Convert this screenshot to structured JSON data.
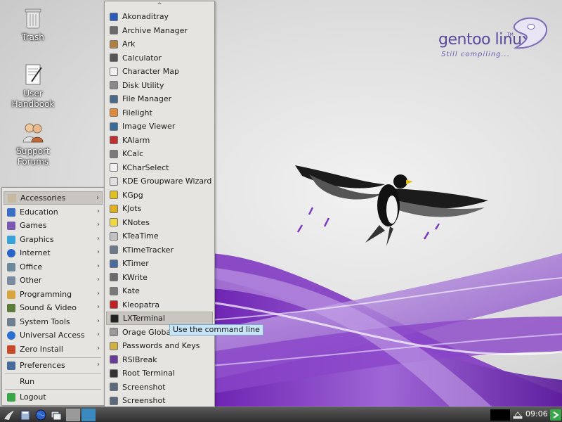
{
  "desktop_icons": [
    {
      "label": "Trash",
      "icon": "trash-icon"
    },
    {
      "label": "User\nHandbook",
      "icon": "handbook-icon"
    },
    {
      "label": "Support\nForums",
      "icon": "support-forums-icon"
    }
  ],
  "branding": {
    "name": "gentoo linux",
    "tm": "TM",
    "tagline": "Still compiling..."
  },
  "main_menu": {
    "categories": [
      {
        "label": "Accessories",
        "icon": "accessories-icon",
        "color": "#c7b8a0",
        "highlighted": true
      },
      {
        "label": "Education",
        "icon": "education-icon",
        "color": "#3a6fc4"
      },
      {
        "label": "Games",
        "icon": "games-icon",
        "color": "#7a5ab0"
      },
      {
        "label": "Graphics",
        "icon": "graphics-icon",
        "color": "#3aa0d8"
      },
      {
        "label": "Internet",
        "icon": "internet-icon",
        "color": "#2b63c9"
      },
      {
        "label": "Office",
        "icon": "office-icon",
        "color": "#6d8a9c"
      },
      {
        "label": "Other",
        "icon": "other-icon",
        "color": "#7a8aa0"
      },
      {
        "label": "Programming",
        "icon": "programming-icon",
        "color": "#d8a640"
      },
      {
        "label": "Sound & Video",
        "icon": "sound-video-icon",
        "color": "#5c7a3a"
      },
      {
        "label": "System Tools",
        "icon": "system-tools-icon",
        "color": "#6f7f8f"
      },
      {
        "label": "Universal Access",
        "icon": "universal-access-icon",
        "color": "#2a6fd0"
      },
      {
        "label": "Zero Install",
        "icon": "zero-install-icon",
        "color": "#c94a2a"
      }
    ],
    "preferences": {
      "label": "Preferences",
      "icon": "preferences-icon",
      "color": "#4a6a9a"
    },
    "run": {
      "label": "Run"
    },
    "logout": {
      "label": "Logout",
      "icon": "logout-icon",
      "color": "#3aa64a"
    }
  },
  "sub_menu": {
    "up_arrow": "^",
    "down_arrow": "v",
    "items": [
      {
        "label": "Akonaditray",
        "icon": "akonaditray-icon",
        "color": "#2a5bbf"
      },
      {
        "label": "Archive Manager",
        "icon": "archive-manager-icon",
        "color": "#6a6a6a"
      },
      {
        "label": "Ark",
        "icon": "ark-icon",
        "color": "#b08040"
      },
      {
        "label": "Calculator",
        "icon": "calculator-icon",
        "color": "#555555"
      },
      {
        "label": "Character Map",
        "icon": "character-map-icon",
        "color": "#f0f0f0"
      },
      {
        "label": "Disk Utility",
        "icon": "disk-utility-icon",
        "color": "#8a8a8a"
      },
      {
        "label": "File Manager",
        "icon": "file-manager-icon",
        "color": "#4a6a8a"
      },
      {
        "label": "Filelight",
        "icon": "filelight-icon",
        "color": "#e08a3a"
      },
      {
        "label": "Image Viewer",
        "icon": "image-viewer-icon",
        "color": "#3a6a9a"
      },
      {
        "label": "KAlarm",
        "icon": "kalarm-icon",
        "color": "#c03030"
      },
      {
        "label": "KCalc",
        "icon": "kcalc-icon",
        "color": "#7a7a7a"
      },
      {
        "label": "KCharSelect",
        "icon": "kcharselect-icon",
        "color": "#f0f0f0"
      },
      {
        "label": "KDE Groupware Wizard",
        "icon": "groupware-wizard-icon",
        "color": "#e0e0e0"
      },
      {
        "label": "KGpg",
        "icon": "kgpg-icon",
        "color": "#e0c020"
      },
      {
        "label": "KJots",
        "icon": "kjots-icon",
        "color": "#e0b020"
      },
      {
        "label": "KNotes",
        "icon": "knotes-icon",
        "color": "#f0d840"
      },
      {
        "label": "KTeaTime",
        "icon": "kteatime-icon",
        "color": "#c0c0c0"
      },
      {
        "label": "KTimeTracker",
        "icon": "ktimetracker-icon",
        "color": "#6a7a8a"
      },
      {
        "label": "KTimer",
        "icon": "ktimer-icon",
        "color": "#4a6aa0"
      },
      {
        "label": "KWrite",
        "icon": "kwrite-icon",
        "color": "#6a6a6a"
      },
      {
        "label": "Kate",
        "icon": "kate-icon",
        "color": "#7a7a7a"
      },
      {
        "label": "Kleopatra",
        "icon": "kleopatra-icon",
        "color": "#c02020"
      },
      {
        "label": "LXTerminal",
        "icon": "lxterminal-icon",
        "color": "#222222",
        "highlighted": true
      },
      {
        "label": "Orage Globaltime",
        "icon": "orage-globaltime-icon",
        "color": "#9a9a9a"
      },
      {
        "label": "Passwords and Keys",
        "icon": "passwords-keys-icon",
        "color": "#d0b040"
      },
      {
        "label": "RSIBreak",
        "icon": "rsibreak-icon",
        "color": "#6a3a9a"
      },
      {
        "label": "Root Terminal",
        "icon": "root-terminal-icon",
        "color": "#333333"
      },
      {
        "label": "Screenshot",
        "icon": "screenshot-icon",
        "color": "#5a6a7a"
      },
      {
        "label": "Screenshot",
        "icon": "screenshot-icon",
        "color": "#5a6a7a"
      }
    ]
  },
  "tooltip": {
    "text": "Use the command line"
  },
  "taskbar": {
    "buttons": [
      "start-menu-icon",
      "file-manager-icon",
      "web-browser-icon",
      "show-desktop-icon",
      "workspace-1-icon",
      "workspace-2-icon"
    ],
    "clock": "09:06"
  }
}
